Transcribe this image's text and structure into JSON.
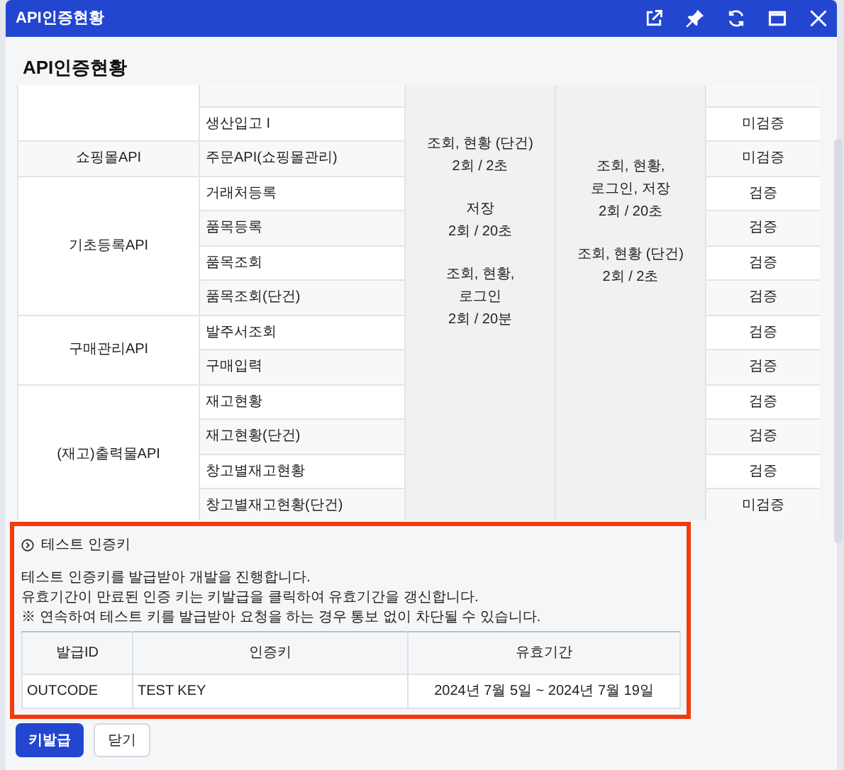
{
  "window": {
    "title": "API인증현황"
  },
  "heading": "API인증현황",
  "api_table": {
    "cut_row_above": true,
    "groups": [
      {
        "apis": [
          {
            "name": "생산입고 I",
            "status": "미검증"
          }
        ]
      },
      {
        "name": "쇼핑몰API",
        "apis": [
          {
            "name": "주문API(쇼핑몰관리)",
            "status": "미검증"
          }
        ]
      },
      {
        "name": "기초등록API",
        "apis": [
          {
            "name": "거래처등록",
            "status": "검증"
          },
          {
            "name": "품목등록",
            "status": "검증"
          },
          {
            "name": "품목조회",
            "status": "검증"
          },
          {
            "name": "품목조회(단건)",
            "status": "검증"
          }
        ]
      },
      {
        "name": "구매관리API",
        "apis": [
          {
            "name": "발주서조회",
            "status": "검증"
          },
          {
            "name": "구매입력",
            "status": "검증"
          }
        ]
      },
      {
        "name": "(재고)출력물API",
        "apis": [
          {
            "name": "재고현황",
            "status": "검증"
          },
          {
            "name": "재고현황(단건)",
            "status": "검증"
          },
          {
            "name": "창고별재고현황",
            "status": "검증"
          },
          {
            "name": "창고별재고현황(단건)",
            "status": "미검증"
          }
        ]
      }
    ],
    "column_3": [
      [
        "조회, 현황 (단건)",
        "2회 / 2초"
      ],
      [
        "저장",
        "2회 / 20초"
      ],
      [
        "조회, 현황,",
        "로그인",
        "2회 / 20분"
      ]
    ],
    "column_4": [
      [
        "조회, 현황,",
        "로그인, 저장",
        "2회 / 20초"
      ],
      [
        "조회, 현황 (단건)",
        "2회 / 2초"
      ]
    ]
  },
  "test_key": {
    "title": "테스트 인증키",
    "notes": [
      "테스트 인증키를 발급받아 개발을 진행합니다.",
      "유효기간이 만료된 인증 키는 키발급을 클릭하여 유효기간을 갱신합니다.",
      "※ 연속하여 테스트 키를 발급받아 요청을 하는 경우 통보 없이 차단될 수 있습니다."
    ],
    "columns": [
      "발급ID",
      "인증키",
      "유효기간"
    ],
    "rows": [
      [
        "OUTCODE",
        "TEST KEY",
        "2024년 7월 5일 ~ 2024년 7월 19일"
      ]
    ]
  },
  "buttons": [
    {
      "label": "키발급",
      "kind": "primary"
    },
    {
      "label": "닫기",
      "kind": "secondary"
    }
  ]
}
